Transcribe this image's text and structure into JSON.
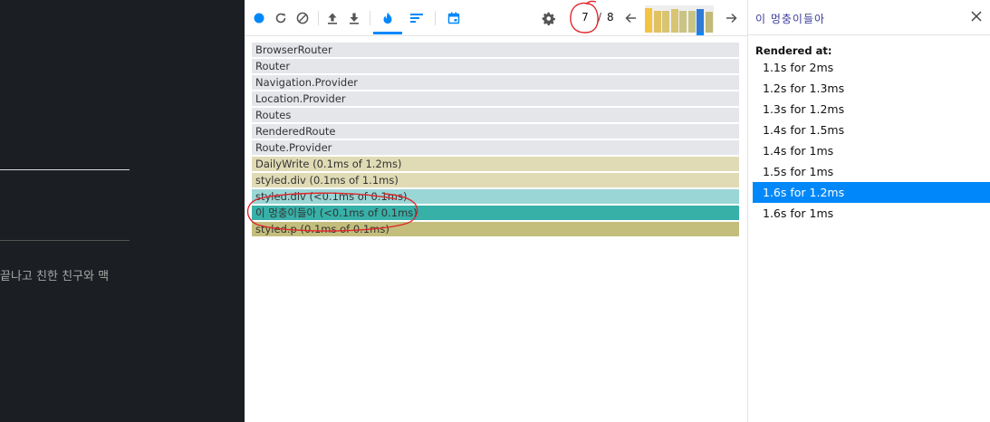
{
  "app_page": {
    "text": "끝나고 친한 친구와 맥"
  },
  "toolbar": {
    "buttons": [
      {
        "name": "record-button",
        "icon": "record-icon"
      },
      {
        "name": "reload-and-profile-button",
        "icon": "reload-icon"
      },
      {
        "name": "clear-profiling-button",
        "icon": "clear-icon"
      },
      {
        "name": "load-profile-button",
        "icon": "upload-icon"
      },
      {
        "name": "save-profile-button",
        "icon": "download-icon"
      },
      {
        "name": "flamegraph-tab",
        "icon": "flame-icon"
      },
      {
        "name": "ranked-tab",
        "icon": "ranked-chart-icon"
      },
      {
        "name": "timeline-tab",
        "icon": "calendar-icon"
      },
      {
        "name": "settings-button",
        "icon": "gear-icon"
      }
    ],
    "commit_index": "7",
    "commit_separator": "/",
    "commit_total": "8",
    "commit_bars": [
      {
        "color": "#f5c342",
        "level": 0.9
      },
      {
        "color": "#e1c262",
        "level": 0.8
      },
      {
        "color": "#d8c472",
        "level": 0.8
      },
      {
        "color": "#d8c472",
        "level": 0.85
      },
      {
        "color": "#c9c484",
        "level": 0.8
      },
      {
        "color": "#c9c484",
        "level": 0.8
      },
      {
        "color": "#2f7bd8",
        "level": 0.85
      },
      {
        "color": "#c2ba78",
        "level": 0.75
      }
    ],
    "colors": {
      "accent": "#0088fa"
    }
  },
  "flame": {
    "rows": [
      {
        "label": "BrowserRouter",
        "color": "#e5e6ea"
      },
      {
        "label": "Router",
        "color": "#e5e6ea"
      },
      {
        "label": "Navigation.Provider",
        "color": "#e5e6ea"
      },
      {
        "label": "Location.Provider",
        "color": "#e5e6ea"
      },
      {
        "label": "Routes",
        "color": "#e5e6ea"
      },
      {
        "label": "RenderedRoute",
        "color": "#e5e6ea"
      },
      {
        "label": "Route.Provider",
        "color": "#e5e6ea"
      },
      {
        "label": "DailyWrite (0.1ms of 1.2ms)",
        "color": "#e0dbb5"
      },
      {
        "label": "styled.div (0.1ms of 1.1ms)",
        "color": "#e0dbb5"
      },
      {
        "label": "styled.div (<0.1ms of 0.1ms)",
        "color": "#9ad6d6"
      },
      {
        "label": "이 멍충이들아 (<0.1ms of 0.1ms)",
        "color": "#37b0a8"
      },
      {
        "label": "styled.p (0.1ms of 0.1ms)",
        "color": "#c3be7c"
      }
    ]
  },
  "sidebar": {
    "title": "이 멍충이들아",
    "rendered_at_label": "Rendered at:",
    "items": [
      "1.1s for 2ms",
      "1.2s for 1.3ms",
      "1.3s for 1.2ms",
      "1.4s for 1.5ms",
      "1.4s for 1ms",
      "1.5s for 1ms",
      "1.6s for 1.2ms",
      "1.6s for 1ms"
    ],
    "selected_index": 6
  }
}
